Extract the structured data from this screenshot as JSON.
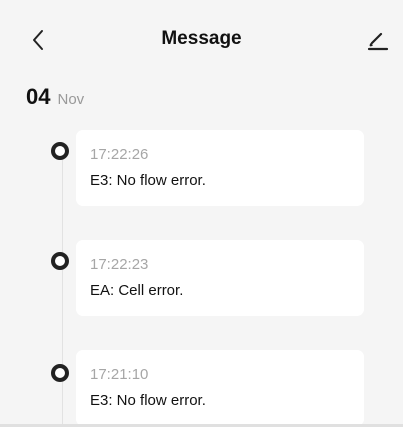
{
  "header": {
    "title": "Message",
    "back_icon": "chevron-left-icon",
    "edit_icon": "pencil-icon"
  },
  "date": {
    "day": "04",
    "month": "Nov"
  },
  "messages": [
    {
      "time": "17:22:26",
      "text": "E3: No flow error."
    },
    {
      "time": "17:22:23",
      "text": "EA: Cell error."
    },
    {
      "time": "17:21:10",
      "text": "E3: No flow error."
    }
  ],
  "colors": {
    "background": "#f5f5f5",
    "card": "#ffffff",
    "dot": "#222222",
    "timestamp": "#a6a6a6"
  }
}
